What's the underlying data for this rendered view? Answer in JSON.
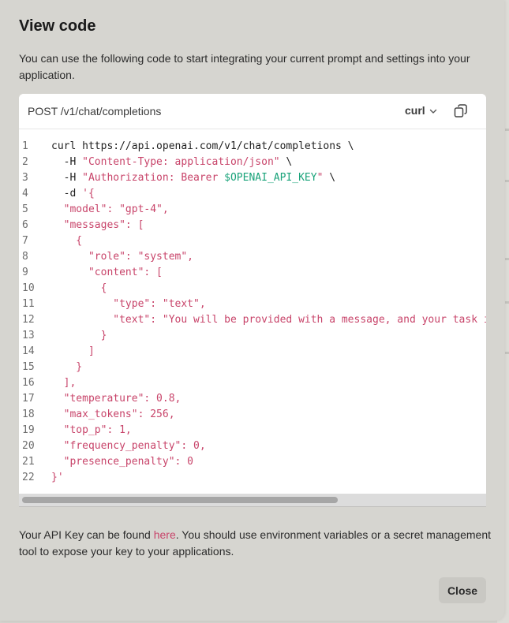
{
  "modal": {
    "title": "View code",
    "description": "You can use the following code to start integrating your current prompt and settings into your application.",
    "endpoint": "POST /v1/chat/completions",
    "language": "curl",
    "footer_pre": "Your API Key can be found ",
    "footer_link": "here",
    "footer_post": ". You should use environment variables or a secret management tool to expose your key to your applications.",
    "close_label": "Close"
  },
  "code": {
    "lines": [
      {
        "n": "1",
        "parts": [
          {
            "t": "curl https://api.openai.com/v1/chat/completions \\",
            "c": ""
          }
        ]
      },
      {
        "n": "2",
        "parts": [
          {
            "t": "  -H ",
            "c": ""
          },
          {
            "t": "\"Content-Type: application/json\"",
            "c": "s"
          },
          {
            "t": " \\",
            "c": ""
          }
        ]
      },
      {
        "n": "3",
        "parts": [
          {
            "t": "  -H ",
            "c": ""
          },
          {
            "t": "\"Authorization: Bearer ",
            "c": "s"
          },
          {
            "t": "$OPENAI_API_KEY",
            "c": "g"
          },
          {
            "t": "\"",
            "c": "s"
          },
          {
            "t": " \\",
            "c": ""
          }
        ]
      },
      {
        "n": "4",
        "parts": [
          {
            "t": "  -d ",
            "c": ""
          },
          {
            "t": "'{",
            "c": "s"
          }
        ]
      },
      {
        "n": "5",
        "parts": [
          {
            "t": "  \"model\": \"gpt-4\",",
            "c": "s"
          }
        ]
      },
      {
        "n": "6",
        "parts": [
          {
            "t": "  \"messages\": [",
            "c": "s"
          }
        ]
      },
      {
        "n": "7",
        "parts": [
          {
            "t": "    {",
            "c": "s"
          }
        ]
      },
      {
        "n": "8",
        "parts": [
          {
            "t": "      \"role\": \"system\",",
            "c": "s"
          }
        ]
      },
      {
        "n": "9",
        "parts": [
          {
            "t": "      \"content\": [",
            "c": "s"
          }
        ]
      },
      {
        "n": "10",
        "parts": [
          {
            "t": "        {",
            "c": "s"
          }
        ]
      },
      {
        "n": "11",
        "parts": [
          {
            "t": "          \"type\": \"text\",",
            "c": "s"
          }
        ]
      },
      {
        "n": "12",
        "parts": [
          {
            "t": "          \"text\": \"You will be provided with a message, and your task i",
            "c": "s"
          }
        ]
      },
      {
        "n": "13",
        "parts": [
          {
            "t": "        }",
            "c": "s"
          }
        ]
      },
      {
        "n": "14",
        "parts": [
          {
            "t": "      ]",
            "c": "s"
          }
        ]
      },
      {
        "n": "15",
        "parts": [
          {
            "t": "    }",
            "c": "s"
          }
        ]
      },
      {
        "n": "16",
        "parts": [
          {
            "t": "  ],",
            "c": "s"
          }
        ]
      },
      {
        "n": "17",
        "parts": [
          {
            "t": "  \"temperature\": 0.8,",
            "c": "s"
          }
        ]
      },
      {
        "n": "18",
        "parts": [
          {
            "t": "  \"max_tokens\": 256,",
            "c": "s"
          }
        ]
      },
      {
        "n": "19",
        "parts": [
          {
            "t": "  \"top_p\": 1,",
            "c": "s"
          }
        ]
      },
      {
        "n": "20",
        "parts": [
          {
            "t": "  \"frequency_penalty\": 0,",
            "c": "s"
          }
        ]
      },
      {
        "n": "21",
        "parts": [
          {
            "t": "  \"presence_penalty\": 0",
            "c": "s"
          }
        ]
      },
      {
        "n": "22",
        "parts": [
          {
            "t": "}'",
            "c": "s"
          }
        ]
      }
    ]
  },
  "colors": {
    "string": "#c8446a",
    "variable": "#1aa37a",
    "link": "#c8446a"
  },
  "icons": {
    "language_chevron": "chevron-down-icon",
    "copy": "copy-icon"
  }
}
